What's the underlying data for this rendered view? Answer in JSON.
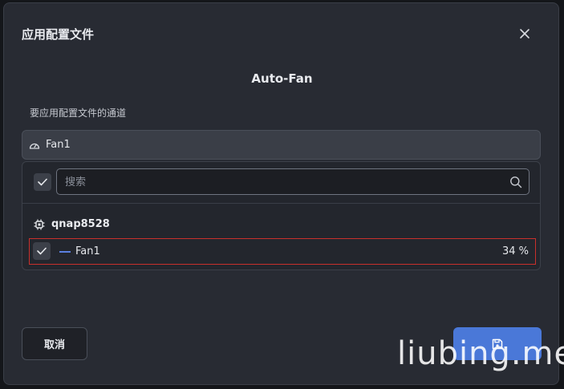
{
  "dialog": {
    "title": "应用配置文件",
    "subtitle": "Auto-Fan",
    "field_label": "要应用配置文件的通道",
    "selected_value": "Fan1"
  },
  "search": {
    "placeholder": "搜索",
    "value": ""
  },
  "device": {
    "name": "qnap8528",
    "icon": "chip-icon"
  },
  "channels": [
    {
      "name": "Fan1",
      "value": "34 %",
      "checked": true,
      "line_color": "#5b7fe0"
    }
  ],
  "buttons": {
    "cancel_label": "取消",
    "save_icon": "save-icon"
  },
  "watermark": "liubing.me",
  "colors": {
    "accent": "#4a78d8",
    "highlight_border": "#c9302c",
    "dialog_bg": "#282b33"
  }
}
